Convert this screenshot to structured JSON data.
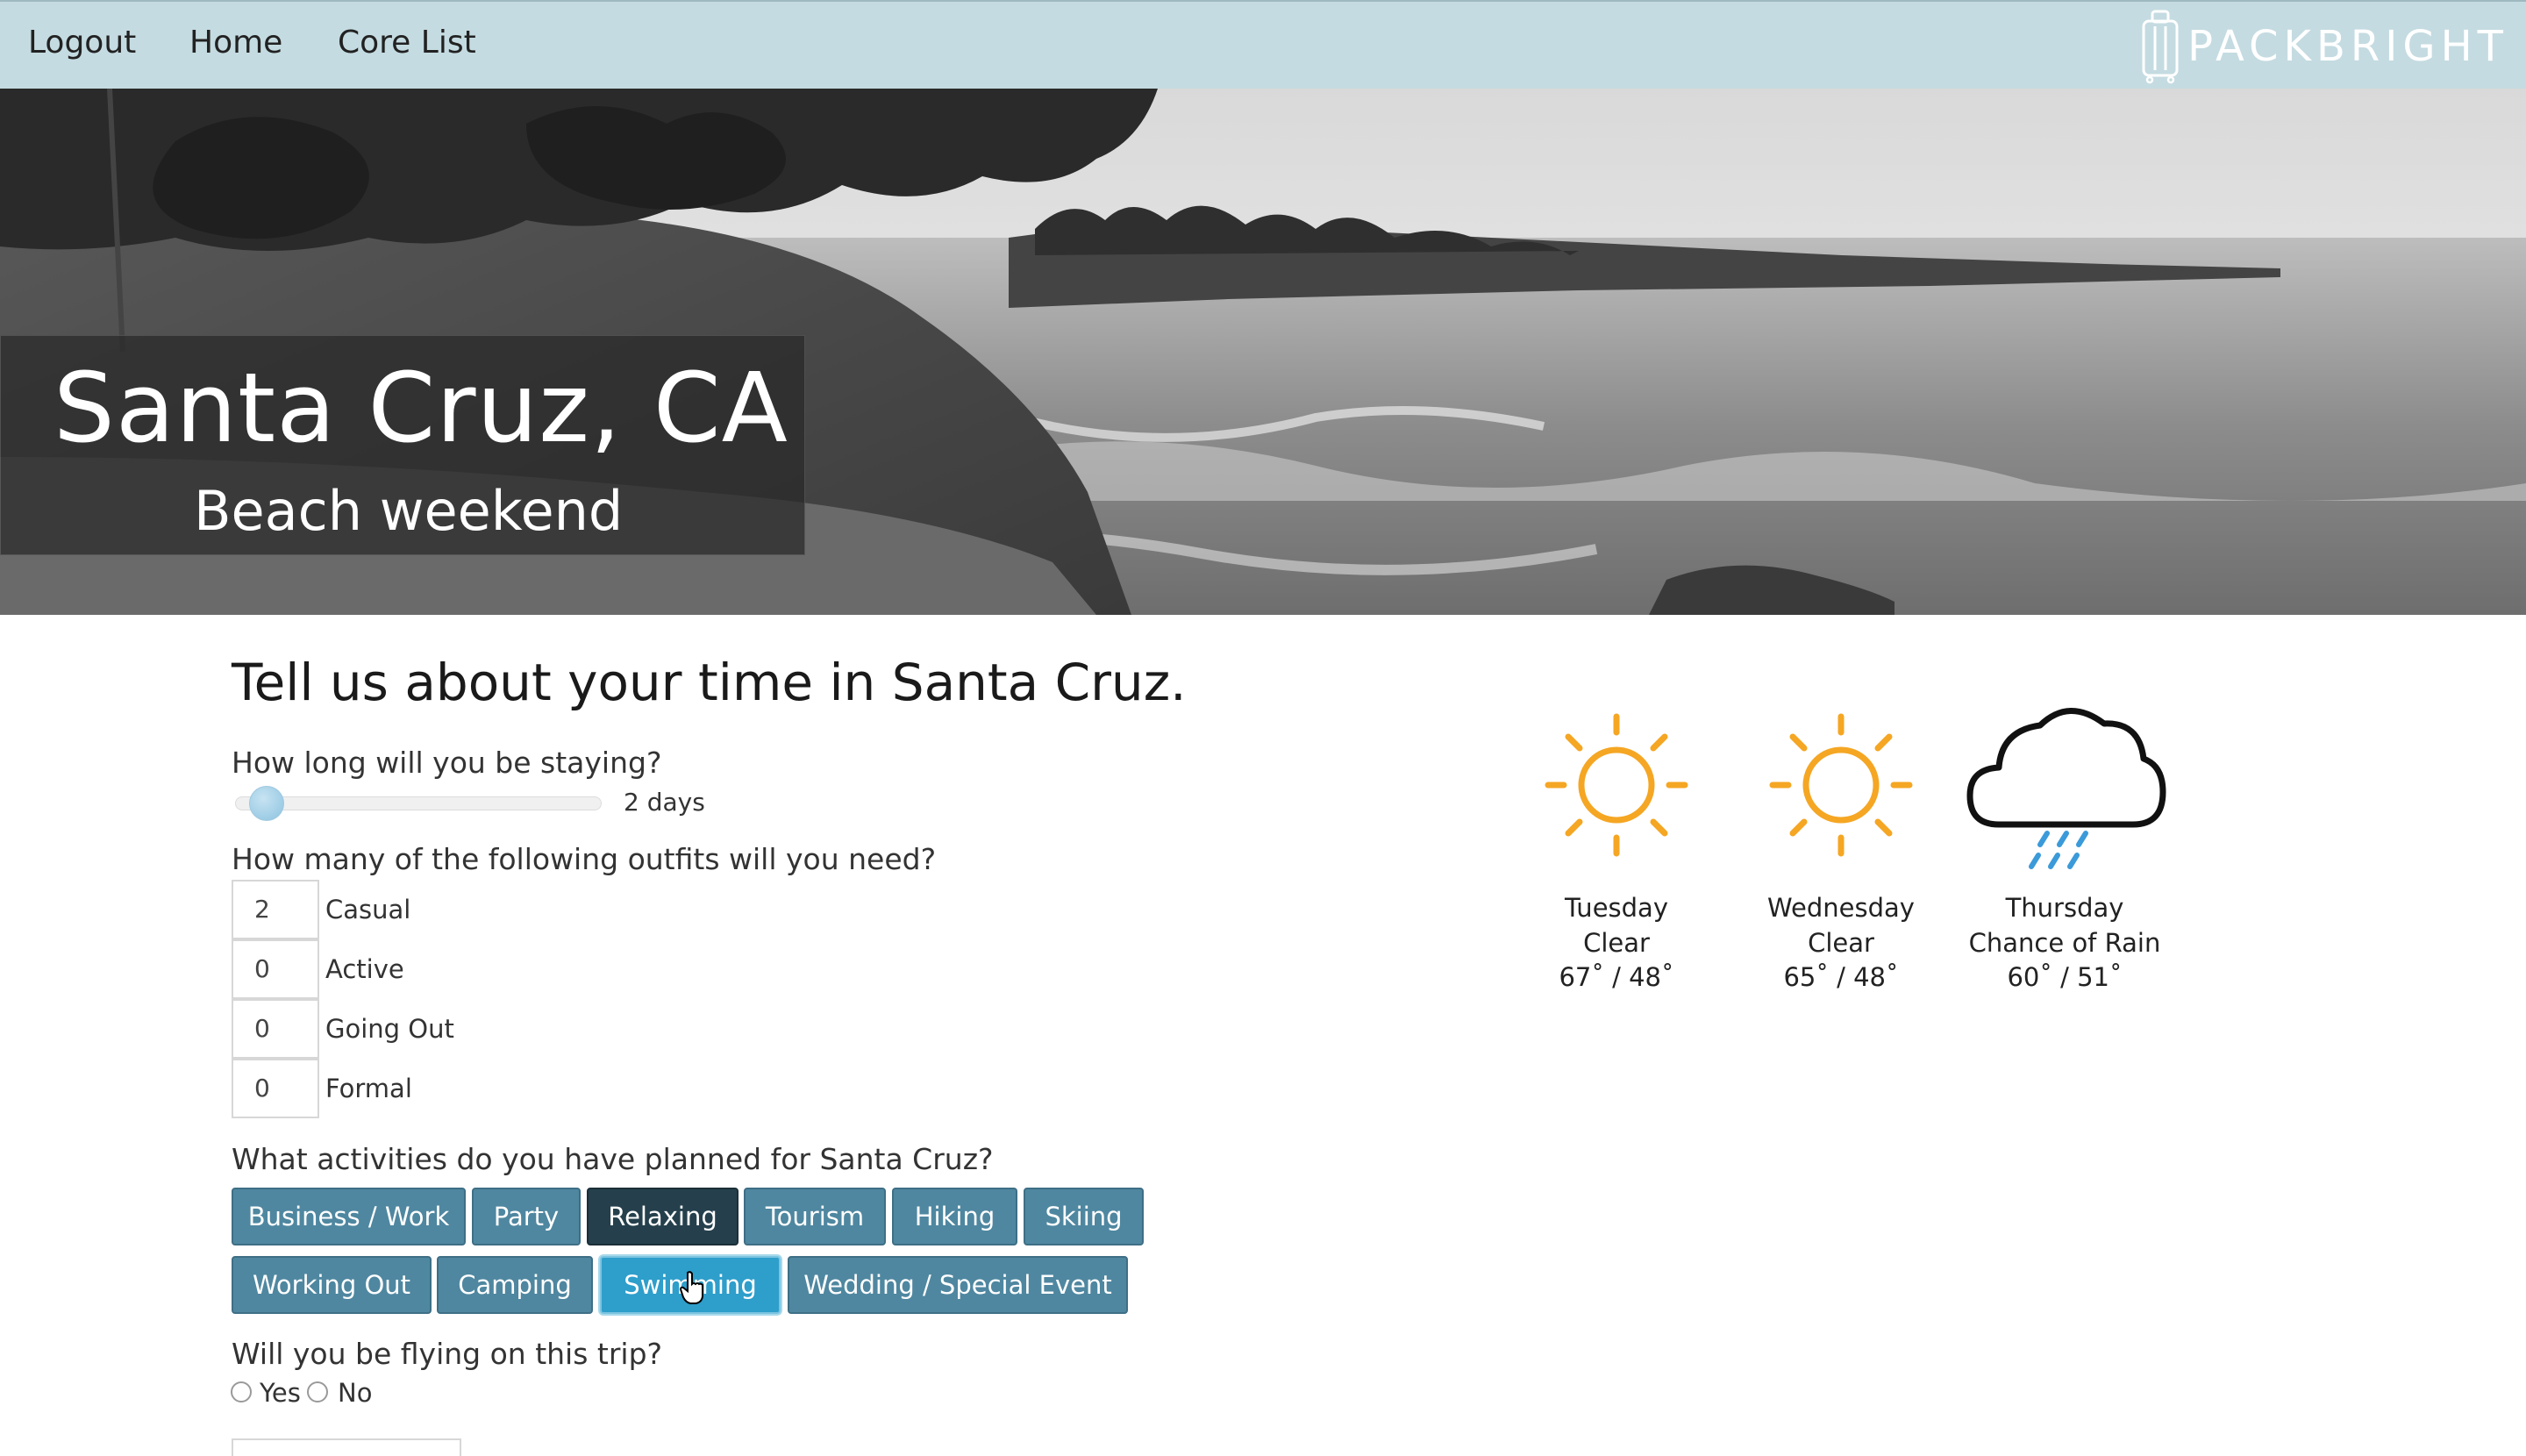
{
  "nav": {
    "links": [
      "Logout",
      "Home",
      "Core List"
    ],
    "logo_text": "PACKBRIGHT"
  },
  "hero": {
    "title": "Santa Cruz, CA",
    "subtitle": "Beach weekend"
  },
  "form": {
    "heading": "Tell us about your time in Santa Cruz.",
    "stay_question": "How long will you be staying?",
    "stay_value": "2 days",
    "stay_level": 0.07,
    "outfits_question": "How many of the following outfits will you need?",
    "outfits": [
      {
        "value": "2",
        "label": "Casual"
      },
      {
        "value": "0",
        "label": "Active"
      },
      {
        "value": "0",
        "label": "Going Out"
      },
      {
        "value": "0",
        "label": "Formal"
      }
    ],
    "activities_question": "What activities do you have planned for Santa Cruz?",
    "activities": [
      {
        "label": "Business / Work",
        "state": "default"
      },
      {
        "label": "Party",
        "state": "default"
      },
      {
        "label": "Relaxing",
        "state": "selected"
      },
      {
        "label": "Tourism",
        "state": "default"
      },
      {
        "label": "Hiking",
        "state": "default"
      },
      {
        "label": "Skiing",
        "state": "default"
      },
      {
        "label": "Working Out",
        "state": "default"
      },
      {
        "label": "Camping",
        "state": "default"
      },
      {
        "label": "Swimming",
        "state": "hover"
      },
      {
        "label": "Wedding / Special Event",
        "state": "default"
      }
    ],
    "flying_question": "Will you be flying on this trip?",
    "flying_options": [
      "Yes",
      "No"
    ]
  },
  "weather": [
    {
      "day": "Tuesday",
      "condition": "Clear",
      "temps": "67˚ / 48˚",
      "icon": "sun-icon"
    },
    {
      "day": "Wednesday",
      "condition": "Clear",
      "temps": "65˚ / 48˚",
      "icon": "sun-icon"
    },
    {
      "day": "Thursday",
      "condition": "Chance of Rain",
      "temps": "60˚ / 51˚",
      "icon": "rain-cloud-icon"
    }
  ],
  "colors": {
    "navbar": "#c4dbe1",
    "button": "#4f87a0",
    "button_selected": "#25404c",
    "button_hover": "#2e9ecb",
    "sun": "#f5a623",
    "rain": "#3b9ad9"
  }
}
